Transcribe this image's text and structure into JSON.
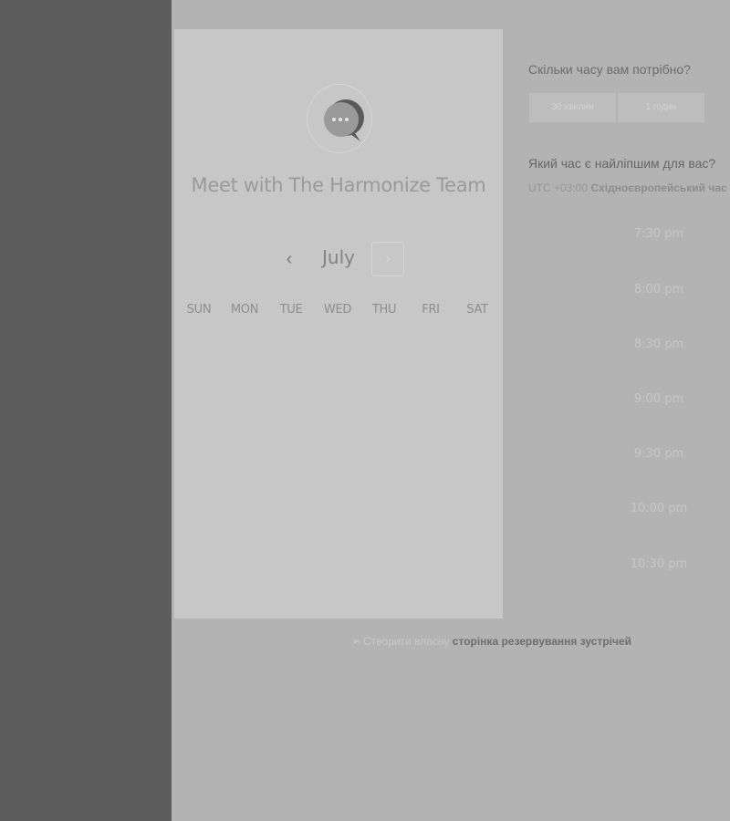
{
  "calendar": {
    "title": "Meet with The Harmonize Team",
    "month": "July",
    "prev_icon": "chevron-left-icon",
    "next_icon": "chevron-right-icon",
    "weekdays": [
      "SUN",
      "MON",
      "TUE",
      "WED",
      "THU",
      "FRI",
      "SAT"
    ]
  },
  "duration": {
    "question": "Скільки часу вам потрібно?",
    "options": [
      "30 хвилин",
      "1 годин"
    ]
  },
  "time_selection": {
    "question": "Який час є найліпшим для вас?",
    "timezone_offset": "UTC +03:00",
    "timezone_name": "Східноєвропейський час",
    "slots": [
      "7:30 pm",
      "8:00 pm",
      "8:30 pm",
      "9:00 pm",
      "9:30 pm",
      "10:00 pm",
      "10:30 pm"
    ]
  },
  "footer": {
    "icon": "pointer-icon",
    "prefix": "Створити власну",
    "link": "сторінка резервування зустрічей"
  },
  "colors": {
    "sidebar": "#5d5d5d",
    "background": "#b3b3b3",
    "card": "#c7c7c7"
  }
}
